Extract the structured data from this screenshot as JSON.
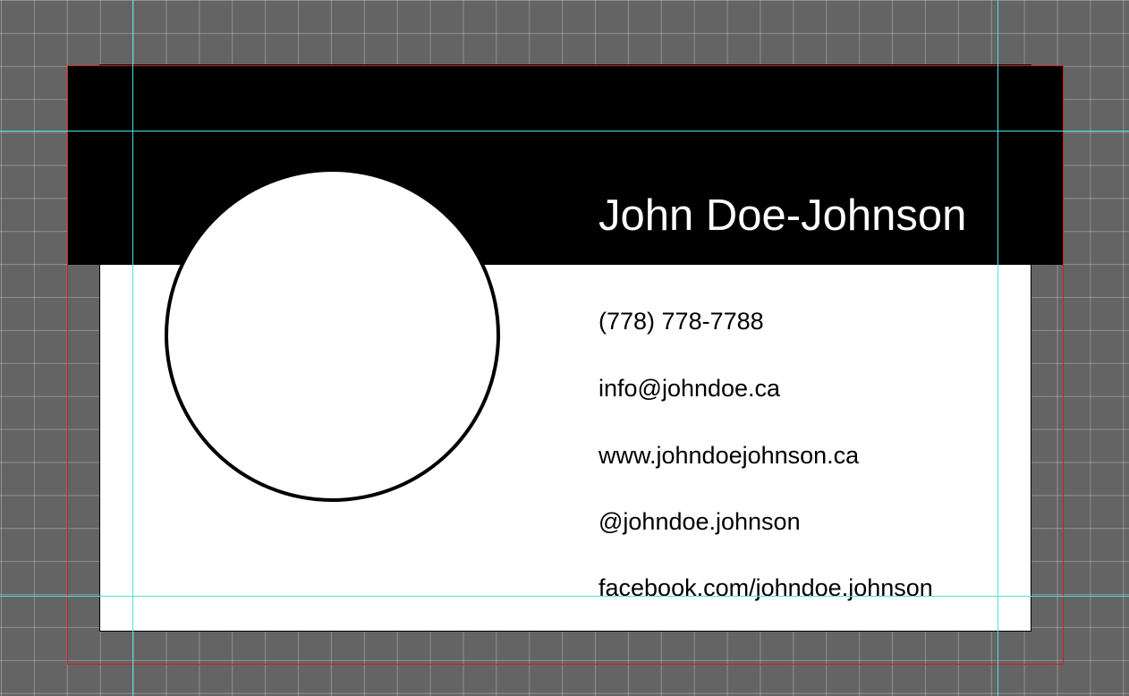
{
  "card": {
    "name": "John Doe-Johnson",
    "phone": "(778) 778-7788",
    "email": "info@johndoe.ca",
    "website": "www.johndoejohnson.ca",
    "social_handle": "@johndoe.johnson",
    "facebook": "facebook.com/johndoe.johnson"
  },
  "colors": {
    "pasteboard": "#646464",
    "artboard": "#ffffff",
    "header_band": "#000000",
    "name_text": "#ffffff",
    "body_text": "#000000",
    "guide": "#4fe3e3",
    "bleed": "#d42020"
  }
}
